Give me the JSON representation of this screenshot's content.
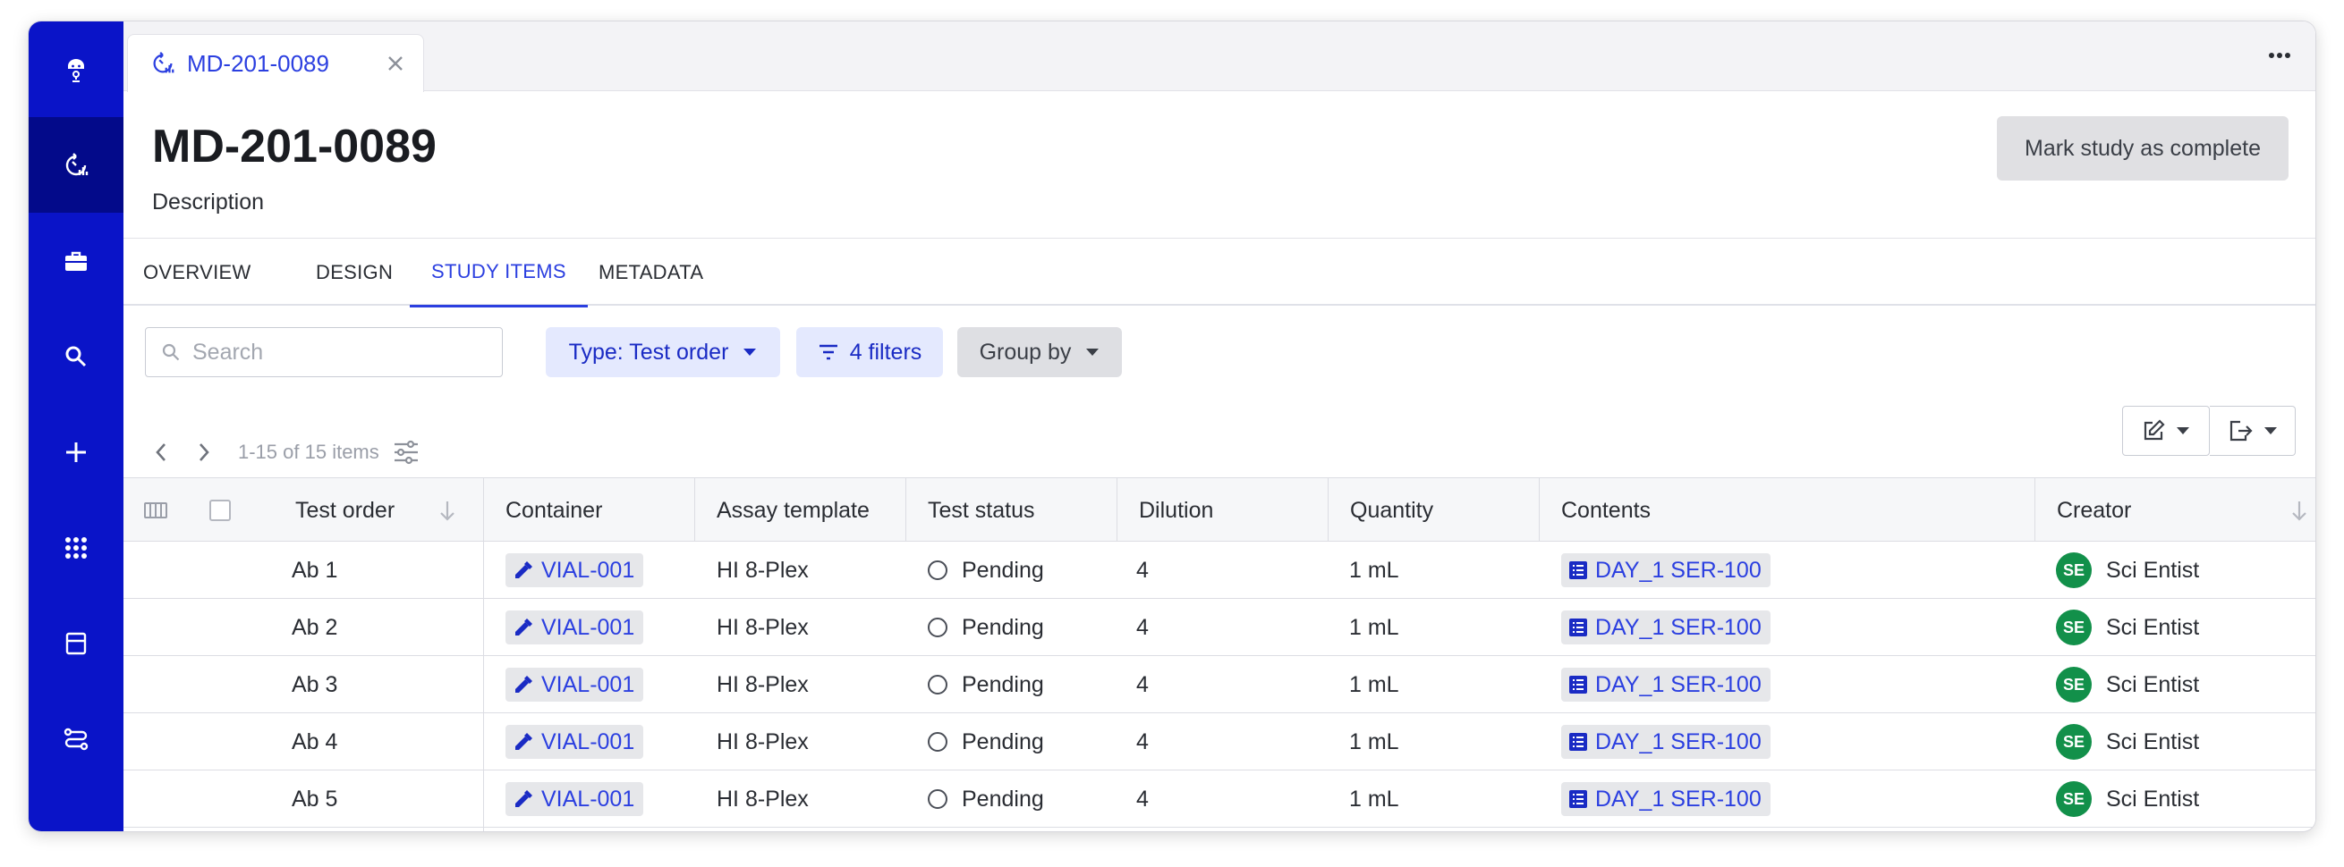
{
  "tab": {
    "title": "MD-201-0089"
  },
  "header": {
    "title": "MD-201-0089",
    "description": "Description",
    "complete_button": "Mark study as complete"
  },
  "nav_tabs": [
    {
      "label": "OVERVIEW"
    },
    {
      "label": "DESIGN"
    },
    {
      "label": "STUDY ITEMS",
      "active": true
    },
    {
      "label": "METADATA"
    }
  ],
  "toolbar": {
    "search_placeholder": "Search",
    "type_filter": "Type: Test order",
    "filters": "4 filters",
    "group_by": "Group by"
  },
  "pager": {
    "range": "1-15 of 15 items"
  },
  "sidebar": {
    "items": [
      {
        "icon": "robot-logo-icon"
      },
      {
        "icon": "study-icon",
        "active": true
      },
      {
        "icon": "briefcase-icon"
      },
      {
        "icon": "search-icon"
      },
      {
        "icon": "plus-icon"
      },
      {
        "icon": "apps-grid-icon"
      },
      {
        "icon": "layout-icon"
      },
      {
        "icon": "workflow-icon"
      }
    ]
  },
  "table": {
    "columns": [
      "Test order",
      "Container",
      "Assay template",
      "Test status",
      "Dilution",
      "Quantity",
      "Contents",
      "Creator"
    ],
    "rows": [
      {
        "test_order": "Ab 1",
        "container": "VIAL-001",
        "assay": "HI 8-Plex",
        "status": "Pending",
        "dilution": "4",
        "quantity": "1 mL",
        "contents": "DAY_1 SER-100",
        "creator_initials": "SE",
        "creator": "Sci Entist"
      },
      {
        "test_order": "Ab 2",
        "container": "VIAL-001",
        "assay": "HI 8-Plex",
        "status": "Pending",
        "dilution": "4",
        "quantity": "1 mL",
        "contents": "DAY_1 SER-100",
        "creator_initials": "SE",
        "creator": "Sci Entist"
      },
      {
        "test_order": "Ab 3",
        "container": "VIAL-001",
        "assay": "HI 8-Plex",
        "status": "Pending",
        "dilution": "4",
        "quantity": "1 mL",
        "contents": "DAY_1 SER-100",
        "creator_initials": "SE",
        "creator": "Sci Entist"
      },
      {
        "test_order": "Ab 4",
        "container": "VIAL-001",
        "assay": "HI 8-Plex",
        "status": "Pending",
        "dilution": "4",
        "quantity": "1 mL",
        "contents": "DAY_1 SER-100",
        "creator_initials": "SE",
        "creator": "Sci Entist"
      },
      {
        "test_order": "Ab 5",
        "container": "VIAL-001",
        "assay": "HI 8-Plex",
        "status": "Pending",
        "dilution": "4",
        "quantity": "1 mL",
        "contents": "DAY_1 SER-100",
        "creator_initials": "SE",
        "creator": "Sci Entist"
      }
    ]
  },
  "colors": {
    "sidebar": "#0a14c8",
    "sidebar_active": "#030a8a",
    "accent": "#2b3fe0",
    "avatar": "#12904a"
  }
}
